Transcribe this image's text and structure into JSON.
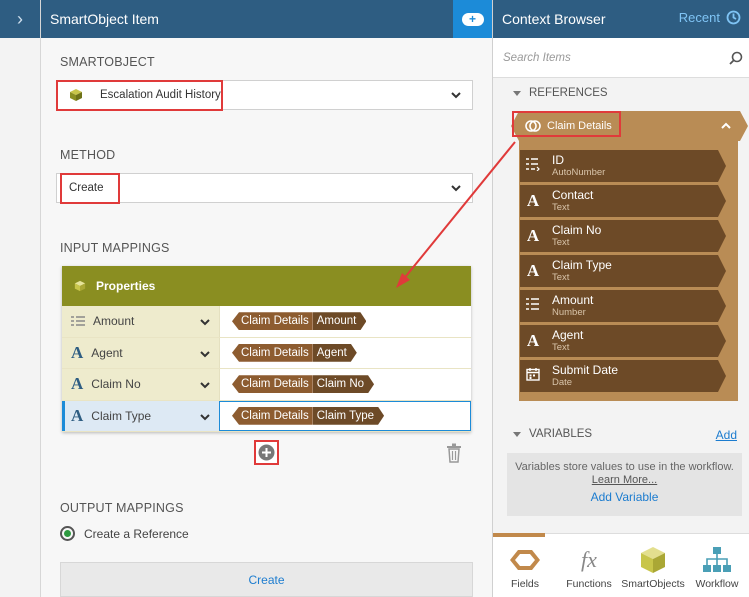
{
  "main": {
    "title": "SmartObject Item",
    "smartobject_label": "SMARTOBJECT",
    "smartobject_value": "Escalation Audit History",
    "method_label": "METHOD",
    "method_value": "Create",
    "input_mappings_label": "INPUT MAPPINGS",
    "mappings_header": "Properties",
    "mappings": [
      {
        "property": "Amount",
        "ref": "Claim Details",
        "field": "Amount"
      },
      {
        "property": "Agent",
        "ref": "Claim Details",
        "field": "Agent"
      },
      {
        "property": "Claim No",
        "ref": "Claim Details",
        "field": "Claim No"
      },
      {
        "property": "Claim Type",
        "ref": "Claim Details",
        "field": "Claim Type"
      }
    ],
    "output_mappings_label": "OUTPUT MAPPINGS",
    "radio_label": "Create a Reference",
    "create_button": "Create"
  },
  "context": {
    "title": "Context Browser",
    "recent": "Recent",
    "search_placeholder": "Search Items",
    "references_label": "REFERENCES",
    "reference_name": "Claim Details",
    "fields": [
      {
        "name": "ID",
        "type": "AutoNumber",
        "icon": "autonumber-icon"
      },
      {
        "name": "Contact",
        "type": "Text",
        "icon": "text-icon"
      },
      {
        "name": "Claim No",
        "type": "Text",
        "icon": "text-icon"
      },
      {
        "name": "Claim Type",
        "type": "Text",
        "icon": "text-icon"
      },
      {
        "name": "Amount",
        "type": "Number",
        "icon": "number-icon"
      },
      {
        "name": "Agent",
        "type": "Text",
        "icon": "text-icon"
      },
      {
        "name": "Submit Date",
        "type": "Date",
        "icon": "date-icon"
      }
    ],
    "variables_label": "VARIABLES",
    "add_label": "Add",
    "variables_text": "Variables store values to use in the workflow.",
    "learn_more": "Learn More...",
    "add_variable": "Add Variable",
    "tabs": [
      "Fields",
      "Functions",
      "SmartObjects",
      "Workflow"
    ]
  },
  "colors": {
    "header_blue": "#2e5d82",
    "accent_blue": "#1c8bd8",
    "olive": "#8a8e21",
    "reference_tan": "#b98c55",
    "field_brown": "#6d4a27",
    "highlight_red": "#e03a3a"
  }
}
